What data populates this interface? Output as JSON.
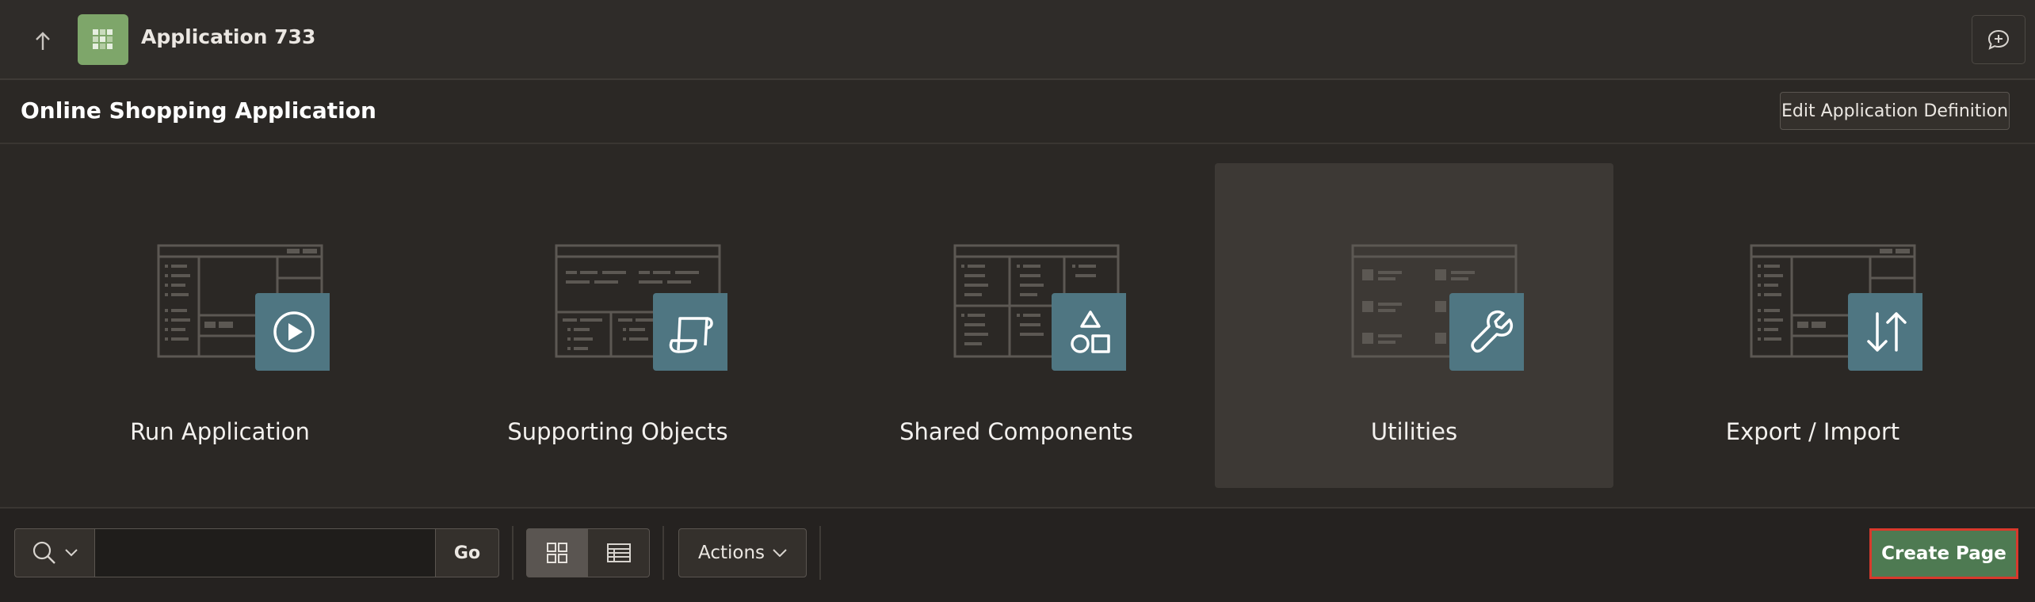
{
  "header": {
    "app_title": "Application 733",
    "up_icon": "arrow-up-icon",
    "app_icon": "grid-app-icon",
    "feedback_icon": "chat-plus-icon"
  },
  "titlebar": {
    "title": "Online Shopping Application",
    "edit_button": "Edit Application Definition"
  },
  "cards": [
    {
      "label": "Run Application",
      "icon": "play-icon"
    },
    {
      "label": "Supporting Objects",
      "icon": "scroll-icon"
    },
    {
      "label": "Shared Components",
      "icon": "shapes-icon"
    },
    {
      "label": "Utilities",
      "icon": "wrench-icon"
    },
    {
      "label": "Export / Import",
      "icon": "arrows-up-down-icon"
    }
  ],
  "toolbar": {
    "search_value": "",
    "go_label": "Go",
    "actions_label": "Actions",
    "create_label": "Create Page",
    "active_view": "icons"
  },
  "colors": {
    "badge": "#4f7682",
    "create_button": "#4e7a52",
    "focus_outline": "#d9392c",
    "app_icon": "#7ea66a"
  }
}
